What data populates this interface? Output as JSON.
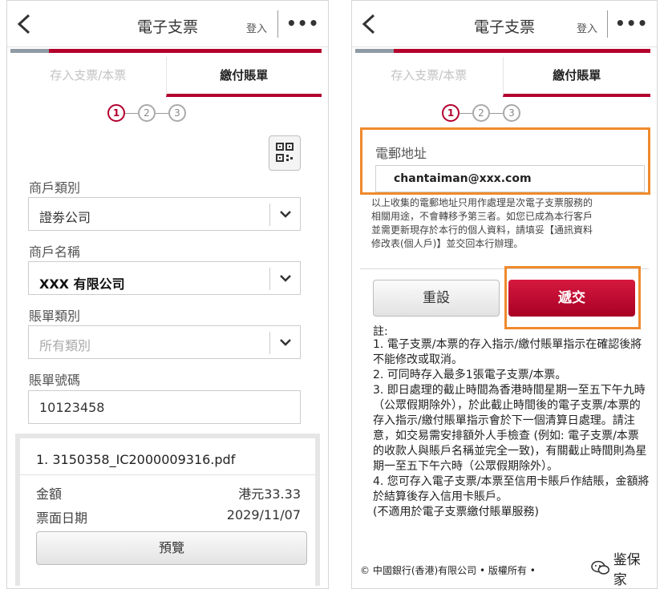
{
  "left": {
    "header": {
      "title": "電子支票",
      "login": "登入",
      "more": "•••"
    },
    "tabs": [
      {
        "label": "存入支票/本票"
      },
      {
        "label": "繳付賬單"
      }
    ],
    "steps": [
      "1",
      "2",
      "3"
    ],
    "merchant_type": {
      "label": "商戶類別",
      "value": "證劵公司"
    },
    "merchant_name": {
      "label": "商戶名稱",
      "value": "XXX 有限公司"
    },
    "bill_type": {
      "label": "賬單類別",
      "placeholder": "所有類別"
    },
    "bill_number": {
      "label": "賬單號碼",
      "value": "10123458"
    },
    "attachment": {
      "filename": "1. 3150358_IC2000009316.pdf",
      "amount_label": "金額",
      "amount": "港元33.33",
      "date_label": "票面日期",
      "date": "2029/11/07",
      "preview_label": "預覽"
    }
  },
  "right": {
    "header": {
      "title": "電子支票",
      "login": "登入",
      "more": "•••"
    },
    "tabs": [
      {
        "label": "存入支票/本票"
      },
      {
        "label": "繳付賬單"
      }
    ],
    "steps": [
      "1",
      "2",
      "3"
    ],
    "email": {
      "label": "電郵地址",
      "value": "chantaiman@xxx.com"
    },
    "notice": "以上收集的電郵地址只用作處理是次電子支票服務的\n相關用途，不會轉移予第三者。如您已成為本行客戶\n並需更新現存於本行的個人資料，請填妥【通訊資料\n修改表(個人戶)】並交回本行辦理。",
    "reset_label": "重設",
    "submit_label": "遞交",
    "notes_title": "註:",
    "notes": [
      "1. 電子支票/本票的存入指示/繳付賬單指示在確認後將不能修改或取消。",
      "2. 可同時存入最多1張電子支票/本票。",
      "3. 即日處理的截止時間為香港時間星期一至五下午九時（公眾假期除外），於此截止時間後的電子支票/本票的存入指示/繳付賬單指示會於下一個清算日處理。請注意，如交易需安排額外人手檢查 (例如: 電子支票/本票的收款人與賬戶名稱並完全一致)，有關截止時間則為星期一至五下午六時（公眾假期除外）。",
      "4. 您可存入電子支票/本票至信用卡賬戶作結賬，金額將於結算後存入信用卡賬戶。",
      "(不適用於電子支票繳付賬單服務)"
    ],
    "footer": "© 中國銀行(香港)有限公司 • 版權所有 •",
    "watermark": "鉴保家"
  },
  "colors": {
    "accent": "#b3002d",
    "highlight": "#ef8a2c",
    "progress_done": "#8f9aa5"
  },
  "icons": [
    "back-arrow-icon",
    "more-dots-icon",
    "qr-code-icon",
    "chevron-down-icon",
    "wechat-icon"
  ]
}
